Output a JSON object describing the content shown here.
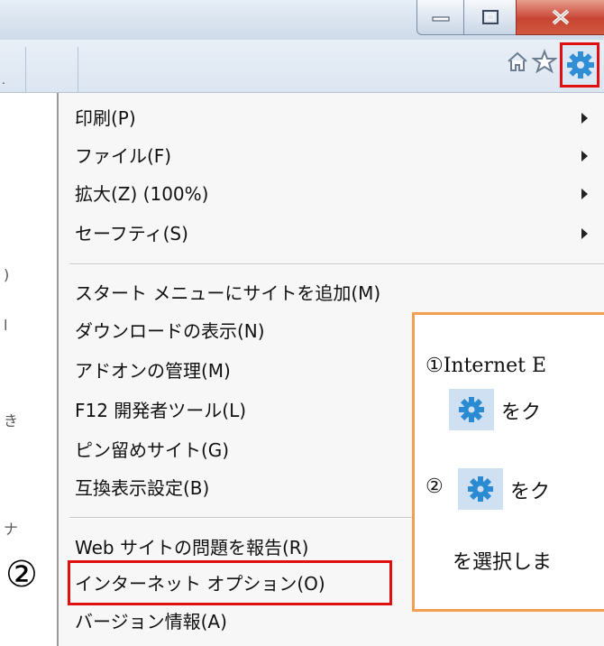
{
  "window_controls": {
    "minimize_icon": "minimize-icon",
    "maximize_icon": "maximize-icon",
    "close_icon": "close-icon"
  },
  "toolbar": {
    "home_icon": "home-icon",
    "favorites_icon": "star-icon",
    "tools_icon": "gear-icon",
    "highlight_color": "#e10e10"
  },
  "menu": {
    "items": [
      {
        "label": "印刷(P)",
        "submenu": true
      },
      {
        "label": "ファイル(F)",
        "submenu": true
      },
      {
        "label": "拡大(Z) (100%)",
        "submenu": true
      },
      {
        "label": "セーフティ(S)",
        "submenu": true
      },
      {
        "label": "スタート メニューにサイトを追加(M)",
        "submenu": false
      },
      {
        "label": "ダウンロードの表示(N)",
        "submenu": false
      },
      {
        "label": "アドオンの管理(M)",
        "submenu": false
      },
      {
        "label": "F12 開発者ツール(L)",
        "submenu": false
      },
      {
        "label": "ピン留めサイト(G)",
        "submenu": false
      },
      {
        "label": "互換表示設定(B)",
        "submenu": false
      },
      {
        "label": "Web サイトの問題を報告(R)",
        "submenu": false
      },
      {
        "label": "インターネット オプション(O)",
        "submenu": false
      },
      {
        "label": "バージョン情報(A)",
        "submenu": false
      }
    ]
  },
  "step_marker": "②",
  "callout": {
    "line1": "①Internet E",
    "line2": "をク",
    "line3_prefix": "②",
    "line3": "をク",
    "line4": "を選択しま",
    "border_color": "#f0a050"
  }
}
